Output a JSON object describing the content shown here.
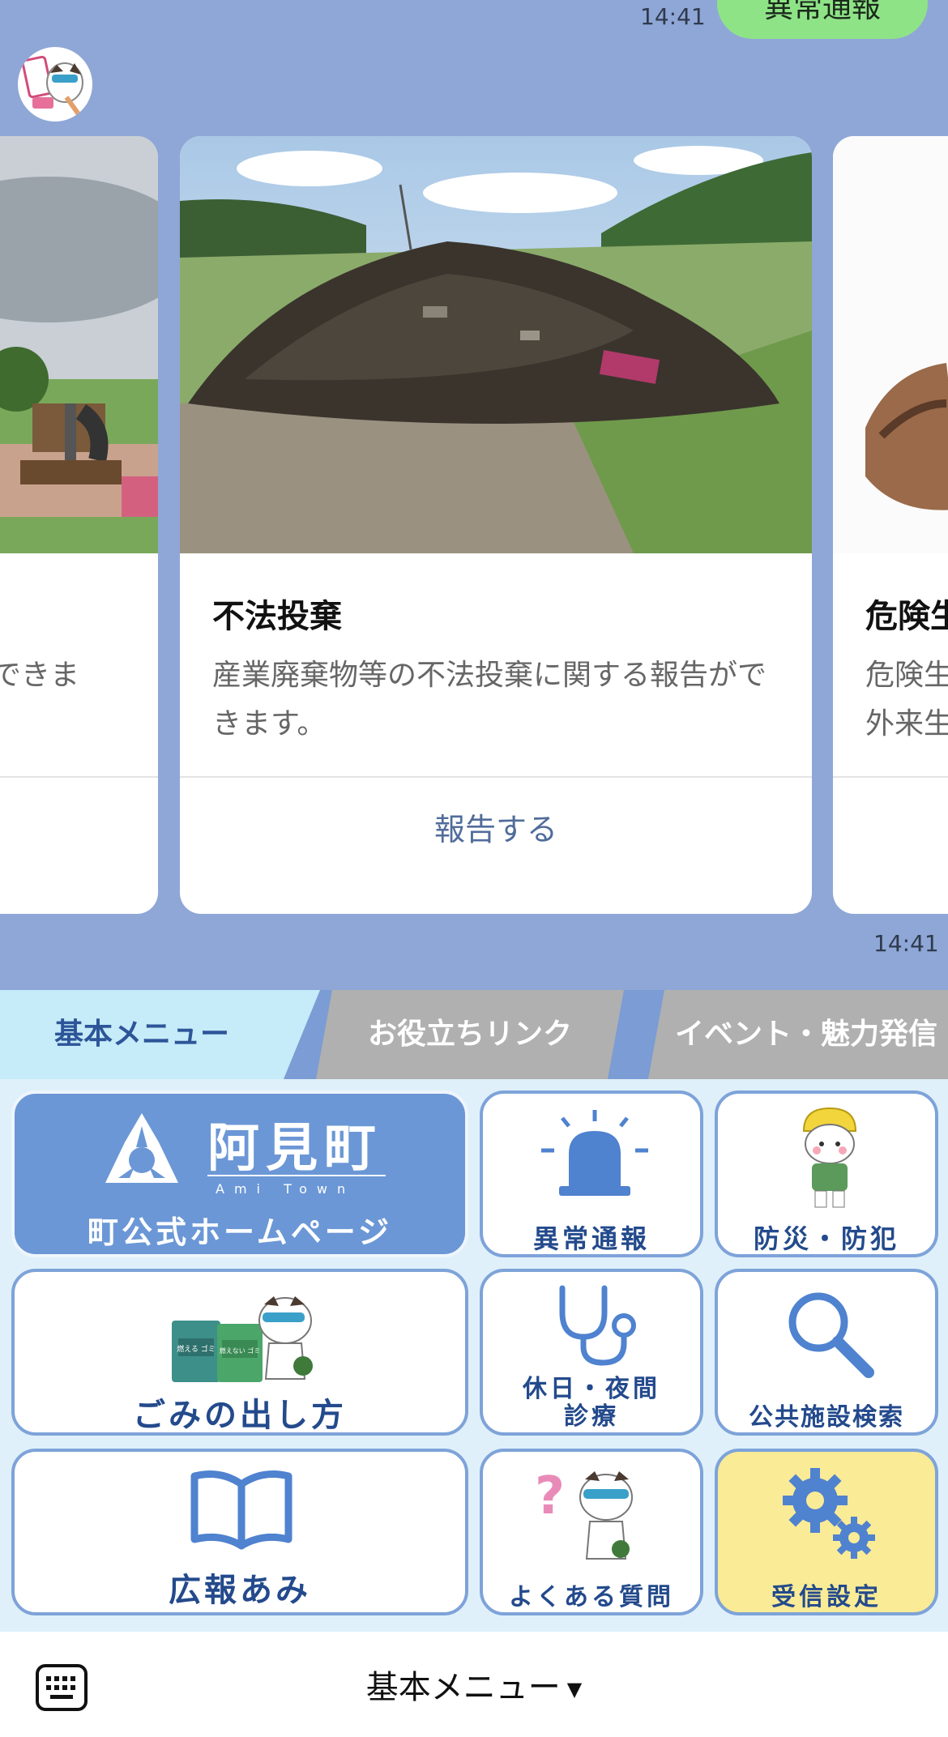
{
  "chat": {
    "time_top": "14:41",
    "green_bubble": "異常通報",
    "time_bottom": "14:41",
    "cards": [
      {
        "title": "",
        "desc": "できま",
        "action": ""
      },
      {
        "title": "不法投棄",
        "desc": "産業廃棄物等の不法投棄に関する報告ができます。",
        "action": "報告する"
      },
      {
        "title": "危険生",
        "desc_line1": "危険生",
        "desc_line2": "外来生",
        "action": ""
      }
    ]
  },
  "rich_menu": {
    "tabs": {
      "basic": "基本メニュー",
      "links": "お役立ちリンク",
      "events": "イベント・魅力発信"
    },
    "home": {
      "logo_text": "阿見町",
      "logo_sub": "Ami Town",
      "label": "町公式ホームページ"
    },
    "tiles": {
      "emergency": "異常通報",
      "disaster": "防災・防犯",
      "garbage": "ごみの出し方",
      "garbage_bin1": "燃える ゴミ",
      "garbage_bin2": "燃えない ゴミ",
      "clinic_line1": "休日・夜間",
      "clinic_line2": "診療",
      "facility": "公共施設検索",
      "newsletter": "広報あみ",
      "faq": "よくある質問",
      "settings": "受信設定"
    }
  },
  "bottom_bar": {
    "menu_label": "基本メニュー",
    "arrow": "▼"
  },
  "colors": {
    "chat_bg": "#8fa7d6",
    "accent_blue": "#6b97d6",
    "label_blue": "#234a8c",
    "settings_yellow": "#faeb96",
    "tab_active": "#c6ebf9"
  }
}
